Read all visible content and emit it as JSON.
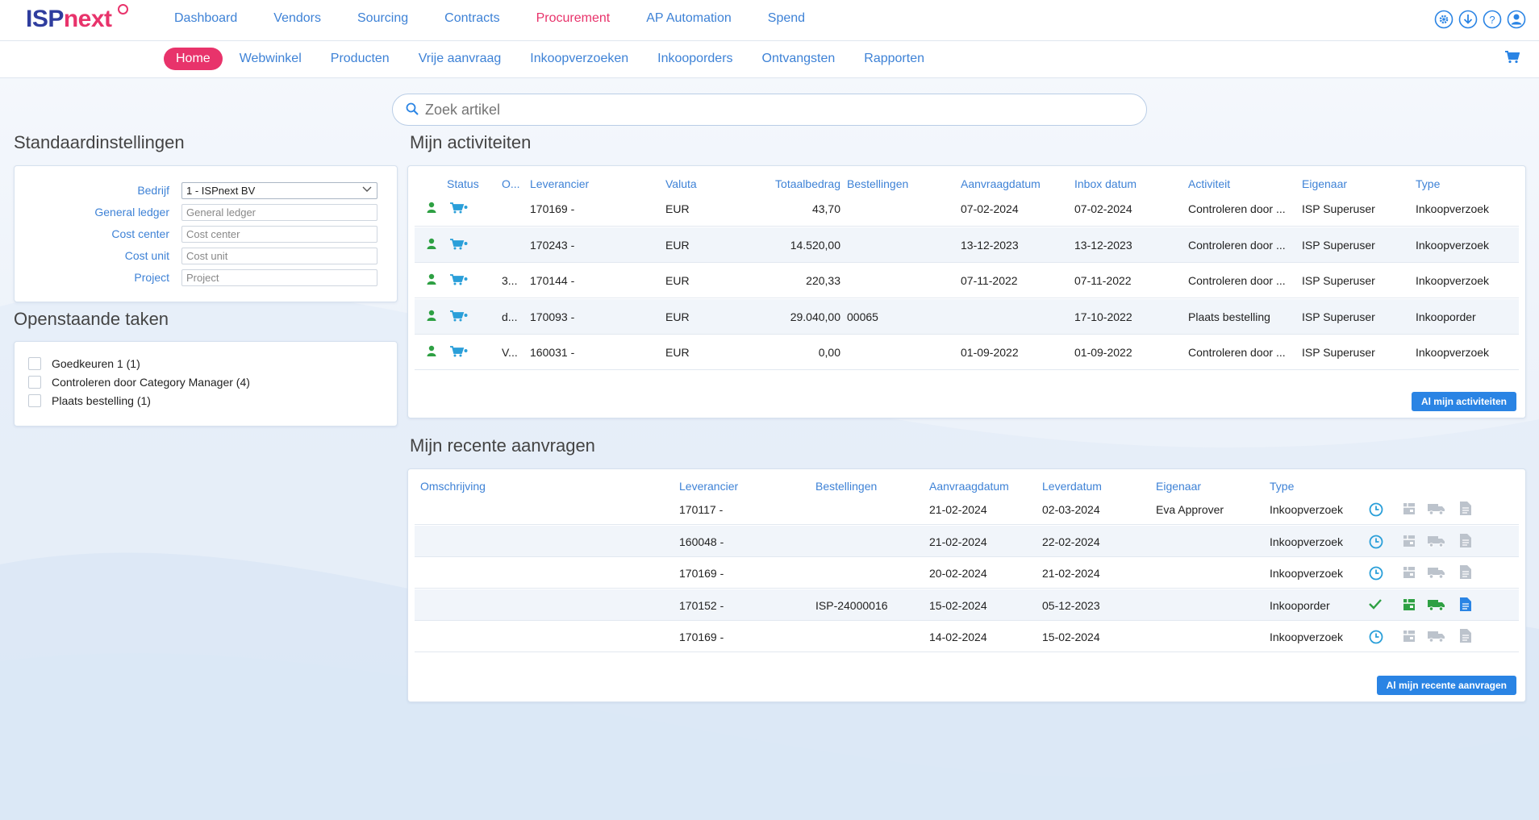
{
  "brand": {
    "part1": "ISP",
    "part2": "next"
  },
  "main_nav": [
    {
      "label": "Dashboard",
      "active": false
    },
    {
      "label": "Vendors",
      "active": false
    },
    {
      "label": "Sourcing",
      "active": false
    },
    {
      "label": "Contracts",
      "active": false
    },
    {
      "label": "Procurement",
      "active": true
    },
    {
      "label": "AP Automation",
      "active": false
    },
    {
      "label": "Spend",
      "active": false
    }
  ],
  "top_icons": [
    "settings-icon",
    "download-icon",
    "help-icon",
    "user-icon"
  ],
  "sub_nav": [
    {
      "label": "Home",
      "active": true
    },
    {
      "label": "Webwinkel"
    },
    {
      "label": "Producten"
    },
    {
      "label": "Vrije aanvraag"
    },
    {
      "label": "Inkoopverzoeken"
    },
    {
      "label": "Inkooporders"
    },
    {
      "label": "Ontvangsten"
    },
    {
      "label": "Rapporten"
    }
  ],
  "search": {
    "placeholder": "Zoek artikel"
  },
  "settings": {
    "title": "Standaardinstellingen",
    "company_label": "Bedrijf",
    "company_value": "1 - ISPnext BV",
    "gl_label": "General ledger",
    "gl_placeholder": "General ledger",
    "cc_label": "Cost center",
    "cc_placeholder": "Cost center",
    "cu_label": "Cost unit",
    "cu_placeholder": "Cost unit",
    "project_label": "Project",
    "project_placeholder": "Project"
  },
  "tasks": {
    "title": "Openstaande taken",
    "items": [
      "Goedkeuren 1 (1)",
      "Controleren door Category Manager (4)",
      "Plaats bestelling (1)"
    ]
  },
  "activities": {
    "title": "Mijn activiteiten",
    "headers": {
      "status": "Status",
      "o": "O...",
      "leverancier": "Leverancier",
      "valuta": "Valuta",
      "totaal": "Totaalbedrag",
      "bestellingen": "Bestellingen",
      "aanvraag": "Aanvraagdatum",
      "inbox": "Inbox datum",
      "activiteit": "Activiteit",
      "eigenaar": "Eigenaar",
      "type": "Type"
    },
    "rows": [
      {
        "o": "",
        "leverancier": "170169 -",
        "valuta": "EUR",
        "totaal": "43,70",
        "bestellingen": "",
        "aanvraag": "07-02-2024",
        "inbox": "07-02-2024",
        "activiteit": "Controleren door ...",
        "eigenaar": "ISP Superuser",
        "type": "Inkoopverzoek"
      },
      {
        "o": "",
        "leverancier": "170243 -",
        "valuta": "EUR",
        "totaal": "14.520,00",
        "bestellingen": "",
        "aanvraag": "13-12-2023",
        "inbox": "13-12-2023",
        "activiteit": "Controleren door ...",
        "eigenaar": "ISP Superuser",
        "type": "Inkoopverzoek"
      },
      {
        "o": "3...",
        "leverancier": "170144 -",
        "valuta": "EUR",
        "totaal": "220,33",
        "bestellingen": "",
        "aanvraag": "07-11-2022",
        "inbox": "07-11-2022",
        "activiteit": "Controleren door ...",
        "eigenaar": "ISP Superuser",
        "type": "Inkoopverzoek"
      },
      {
        "o": "d...",
        "leverancier": "170093 -",
        "valuta": "EUR",
        "totaal": "29.040,00",
        "bestellingen": "00065",
        "aanvraag": "",
        "inbox": "17-10-2022",
        "activiteit": "Plaats bestelling",
        "eigenaar": "ISP Superuser",
        "type": "Inkooporder"
      },
      {
        "o": "V...",
        "leverancier": "160031 -",
        "valuta": "EUR",
        "totaal": "0,00",
        "bestellingen": "",
        "aanvraag": "01-09-2022",
        "inbox": "01-09-2022",
        "activiteit": "Controleren door ...",
        "eigenaar": "ISP Superuser",
        "type": "Inkoopverzoek"
      }
    ],
    "button": "Al mijn activiteiten"
  },
  "recent": {
    "title": "Mijn recente aanvragen",
    "headers": {
      "omschrijving": "Omschrijving",
      "leverancier": "Leverancier",
      "bestellingen": "Bestellingen",
      "aanvraag": "Aanvraagdatum",
      "lever": "Leverdatum",
      "eigenaar": "Eigenaar",
      "type": "Type"
    },
    "rows": [
      {
        "omschrijving": "",
        "leverancier": "170117 -",
        "bestellingen": "",
        "aanvraag": "21-02-2024",
        "lever": "02-03-2024",
        "eigenaar": "Eva Approver",
        "type": "Inkoopverzoek",
        "done": false
      },
      {
        "omschrijving": "",
        "leverancier": "160048 -",
        "bestellingen": "",
        "aanvraag": "21-02-2024",
        "lever": "22-02-2024",
        "eigenaar": "",
        "type": "Inkoopverzoek",
        "done": false
      },
      {
        "omschrijving": "",
        "leverancier": "170169 -",
        "bestellingen": "",
        "aanvraag": "20-02-2024",
        "lever": "21-02-2024",
        "eigenaar": "",
        "type": "Inkoopverzoek",
        "done": false
      },
      {
        "omschrijving": "",
        "leverancier": "170152 -",
        "bestellingen": "ISP-24000016",
        "aanvraag": "15-02-2024",
        "lever": "05-12-2023",
        "eigenaar": "",
        "type": "Inkooporder",
        "done": true
      },
      {
        "omschrijving": "",
        "leverancier": "170169 -",
        "bestellingen": "",
        "aanvraag": "14-02-2024",
        "lever": "15-02-2024",
        "eigenaar": "",
        "type": "Inkoopverzoek",
        "done": false
      }
    ],
    "button": "Al mijn recente aanvragen"
  },
  "colors": {
    "brand_blue": "#2f3d9e",
    "brand_pink": "#e8336b",
    "link": "#3e82d6",
    "green": "#2ea043",
    "button": "#2a84e4"
  }
}
